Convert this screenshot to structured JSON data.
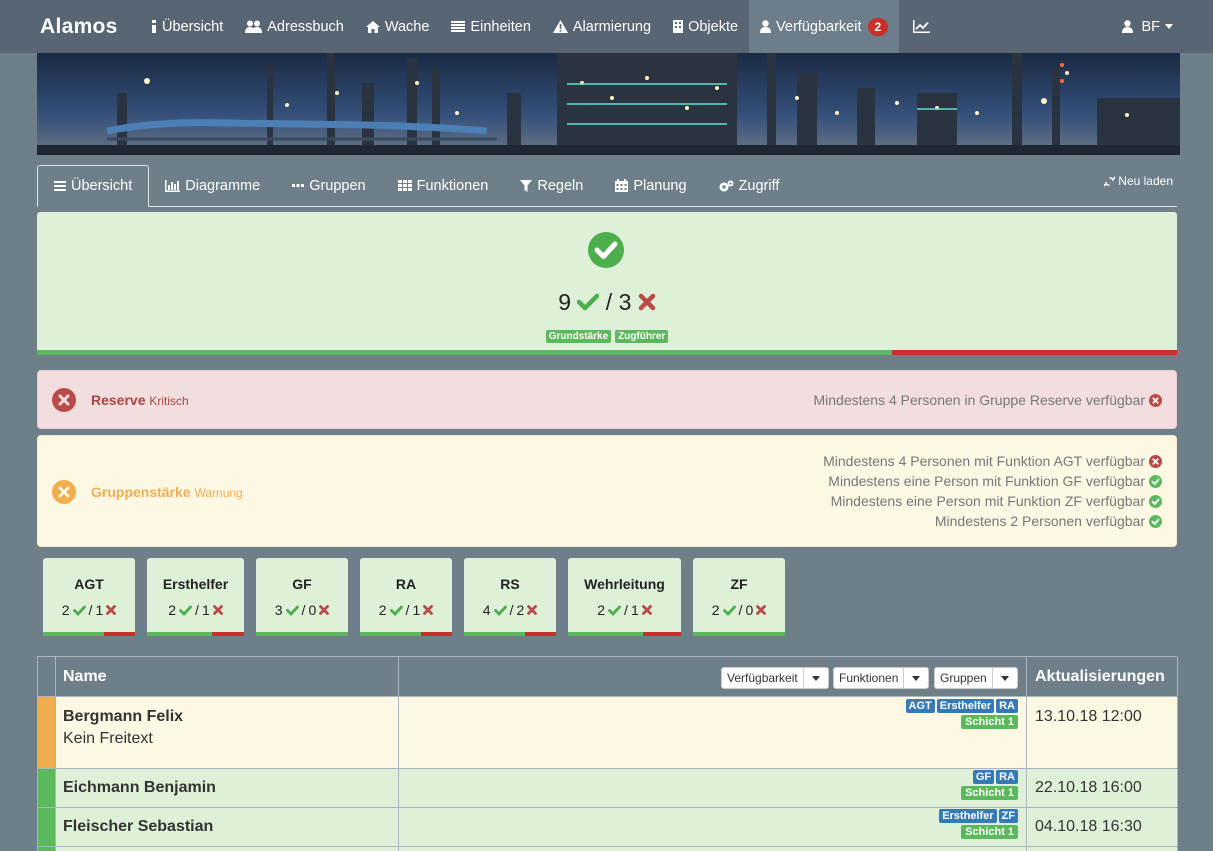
{
  "navbar": {
    "brand": "Alamos",
    "items": [
      {
        "label": "Übersicht",
        "icon": "info-icon"
      },
      {
        "label": "Adressbuch",
        "icon": "users-icon"
      },
      {
        "label": "Wache",
        "icon": "home-icon"
      },
      {
        "label": "Einheiten",
        "icon": "list-icon"
      },
      {
        "label": "Alarmierung",
        "icon": "warning-icon"
      },
      {
        "label": "Objekte",
        "icon": "building-icon"
      },
      {
        "label": "Verfügbarkeit",
        "icon": "user-icon",
        "badge": "2"
      }
    ],
    "chart_icon": "line-chart-icon",
    "user": "BF"
  },
  "tabs": [
    {
      "label": "Übersicht",
      "icon": "bars-icon"
    },
    {
      "label": "Diagramme",
      "icon": "bar-chart-icon"
    },
    {
      "label": "Gruppen",
      "icon": "ellipsis-icon"
    },
    {
      "label": "Funktionen",
      "icon": "grid-icon"
    },
    {
      "label": "Regeln",
      "icon": "filter-icon"
    },
    {
      "label": "Planung",
      "icon": "calendar-icon"
    },
    {
      "label": "Zugriff",
      "icon": "cogs-icon"
    }
  ],
  "reload_label": "Neu laden",
  "status": {
    "available": "9",
    "separator": "/",
    "unavailable": "3",
    "labels": [
      "Grundstärke",
      "Zugführer"
    ],
    "available_fraction": 0.75
  },
  "alerts": {
    "danger": {
      "title": "Reserve",
      "level": "Kritisch",
      "rules": [
        {
          "text": "Mindestens 4 Personen in Gruppe Reserve verfügbar",
          "ok": false
        }
      ]
    },
    "warning": {
      "title": "Gruppenstärke",
      "level": "Warnung",
      "rules": [
        {
          "text": "Mindestens 4 Personen mit Funktion AGT verfügbar",
          "ok": false
        },
        {
          "text": "Mindestens eine Person mit Funktion GF verfügbar",
          "ok": true
        },
        {
          "text": "Mindestens eine Person mit Funktion ZF verfügbar",
          "ok": true
        },
        {
          "text": "Mindestens 2 Personen verfügbar",
          "ok": true
        }
      ]
    }
  },
  "functions": [
    {
      "name": "AGT",
      "available": "2",
      "unavailable": "1"
    },
    {
      "name": "Ersthelfer",
      "available": "2",
      "unavailable": "1"
    },
    {
      "name": "GF",
      "available": "3",
      "unavailable": "0"
    },
    {
      "name": "RA",
      "available": "2",
      "unavailable": "1"
    },
    {
      "name": "RS",
      "available": "4",
      "unavailable": "2"
    },
    {
      "name": "Wehrleitung",
      "available": "2",
      "unavailable": "1"
    },
    {
      "name": "ZF",
      "available": "2",
      "unavailable": "0"
    }
  ],
  "table": {
    "headers": {
      "name": "Name",
      "updates": "Aktualisierungen"
    },
    "filters": [
      "Verfügbarkeit",
      "Funktionen",
      "Gruppen"
    ],
    "rows": [
      {
        "name": "Bergmann Felix",
        "note": "Kein Freitext",
        "functions": [
          "AGT",
          "Ersthelfer",
          "RA"
        ],
        "group": "Schicht 1",
        "updated": "13.10.18 12:00",
        "status": "warning"
      },
      {
        "name": "Eichmann Benjamin",
        "note": "",
        "functions": [
          "GF",
          "RA"
        ],
        "group": "Schicht 1",
        "updated": "22.10.18 16:00",
        "status": "available"
      },
      {
        "name": "Fleischer Sebastian",
        "note": "",
        "functions": [
          "Ersthelfer",
          "ZF"
        ],
        "group": "Schicht 1",
        "updated": "04.10.18 16:30",
        "status": "available"
      }
    ]
  },
  "colors": {
    "navbar": "#586573",
    "background": "#6e7f8a",
    "success": "#5cb85c",
    "danger": "#c9302c",
    "warning": "#f0ad4e",
    "label_blue": "#337ab7"
  }
}
